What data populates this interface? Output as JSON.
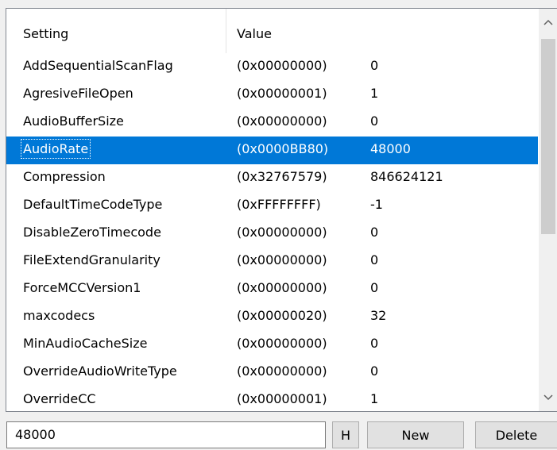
{
  "list": {
    "columns": [
      "Setting",
      "Value"
    ],
    "rows": [
      {
        "setting": "AddSequentialScanFlag",
        "hex": "(0x00000000)",
        "value": "0",
        "selected": false
      },
      {
        "setting": "AgresiveFileOpen",
        "hex": "(0x00000001)",
        "value": "1",
        "selected": false
      },
      {
        "setting": "AudioBufferSize",
        "hex": "(0x00000000)",
        "value": "0",
        "selected": false
      },
      {
        "setting": "AudioRate",
        "hex": "(0x0000BB80)",
        "value": "48000",
        "selected": true
      },
      {
        "setting": "Compression",
        "hex": "(0x32767579)",
        "value": "846624121",
        "selected": false
      },
      {
        "setting": "DefaultTimeCodeType",
        "hex": "(0xFFFFFFFF)",
        "value": "-1",
        "selected": false
      },
      {
        "setting": "DisableZeroTimecode",
        "hex": "(0x00000000)",
        "value": "0",
        "selected": false
      },
      {
        "setting": "FileExtendGranularity",
        "hex": "(0x00000000)",
        "value": "0",
        "selected": false
      },
      {
        "setting": "ForceMCCVersion1",
        "hex": "(0x00000000)",
        "value": "0",
        "selected": false
      },
      {
        "setting": "maxcodecs",
        "hex": "(0x00000020)",
        "value": "32",
        "selected": false
      },
      {
        "setting": "MinAudioCacheSize",
        "hex": "(0x00000000)",
        "value": "0",
        "selected": false
      },
      {
        "setting": "OverrideAudioWriteType",
        "hex": "(0x00000000)",
        "value": "0",
        "selected": false
      },
      {
        "setting": "OverrideCC",
        "hex": "(0x00000001)",
        "value": "1",
        "selected": false
      }
    ]
  },
  "scrollbar": {
    "up_icon": "chevron-up-icon",
    "down_icon": "chevron-down-icon"
  },
  "editor": {
    "value": "48000",
    "h_label": "H",
    "new_label": "New",
    "delete_label": "Delete"
  },
  "colors": {
    "selection": "#0078d7",
    "window_bg": "#f0f0f0",
    "list_bg": "#ffffff"
  }
}
